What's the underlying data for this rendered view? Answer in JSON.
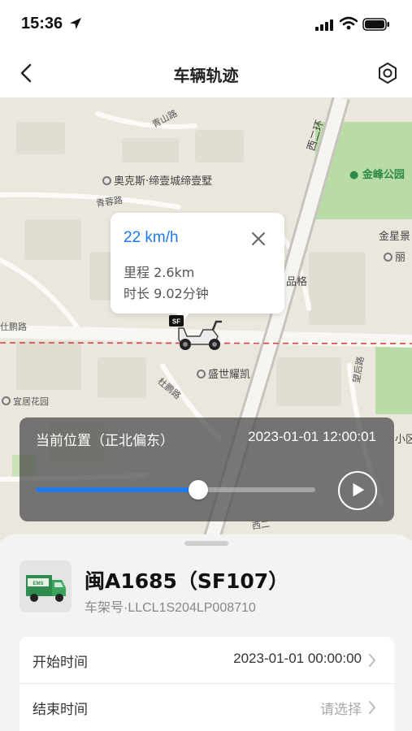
{
  "status_bar": {
    "time": "15:36"
  },
  "nav": {
    "title": "车辆轨迹"
  },
  "map": {
    "labels": {
      "qingshan_road": "青山路",
      "aokesi": "奥克斯·缔壹城缔壹墅",
      "qingrong_road": "青蓉路",
      "xi_er_huan": "西二环",
      "jinfeng_park": "金峰公园",
      "jinxing": "金星景",
      "li": "丽",
      "pinge": "品格",
      "shipeng_road": "仕鹏路",
      "dupeng_road": "杜鹏路",
      "shengshi_lingkai": "盛世耀凯",
      "yiju_garden": "宜居花园",
      "wanghou_road": "望后路",
      "xiao_qu": "小区",
      "xiduan": "西二"
    }
  },
  "popup": {
    "speed": "22 km/h",
    "mileage": "里程 2.6km",
    "duration": "时长 9.02分钟"
  },
  "playback": {
    "heading": "当前位置（正北偏东）",
    "timestamp": "2023-01-01 12:00:01",
    "progress_percent": 58
  },
  "vehicle": {
    "name": "闽A1685（SF107）",
    "frame_no": "车架号·LLCL1S204LP008710"
  },
  "fields": {
    "start_label": "开始时间",
    "start_value": "2023-01-01 00:00:00",
    "end_label": "结束时间",
    "end_placeholder": "请选择"
  },
  "colors": {
    "accent": "#1f7ae8",
    "route": "#d64545",
    "park": "#b9dba6"
  }
}
